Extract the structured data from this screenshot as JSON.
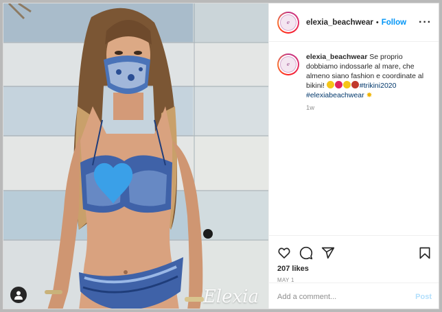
{
  "post": {
    "watermark": "Elexia",
    "account": {
      "username": "elexia_beachwear",
      "separator": "•",
      "follow_label": "Follow",
      "more_label": "···"
    },
    "caption": {
      "text": " Se proprio dobbiamo indossarle al mare, che almeno siano fashion e coordinate al bikini! ",
      "emoji_colors": [
        "#f5c518",
        "#e0245e",
        "#f5c518",
        "#c0392b"
      ],
      "hashtags": [
        "#trikini2020",
        "#elexiabeachwear"
      ],
      "trailing_emoji": "✸",
      "age": "1w"
    },
    "stats": {
      "likes": "207 likes",
      "date": "MAY 1"
    },
    "comment": {
      "placeholder": "Add a comment...",
      "post_label": "Post"
    },
    "icons": {
      "like": "heart-icon",
      "comment": "comment-icon",
      "share": "share-icon",
      "save": "bookmark-icon",
      "tagged": "user-icon"
    },
    "colors": {
      "link": "#0095f6",
      "hashtag": "#00376b",
      "muted": "#8e8e8e",
      "post_disabled": "#b2dffc",
      "censor_heart": "#3aa0e8"
    }
  }
}
